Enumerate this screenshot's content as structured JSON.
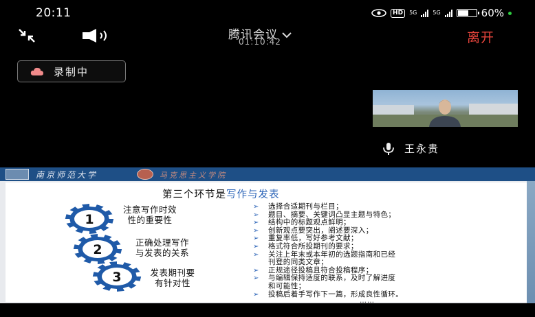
{
  "status_bar": {
    "time": "20:11",
    "hd_label": "HD",
    "net1": "5G",
    "net2": "5G",
    "battery_percent": "60%",
    "battery_level": 0.6
  },
  "toolbar": {
    "meeting_title": "腾讯会议",
    "timer": "01:10:42",
    "leave_label": "离开"
  },
  "record": {
    "label": "录制中"
  },
  "participant": {
    "name": "王永贵"
  },
  "slide": {
    "title_prefix": "第三个环节是",
    "title_highlight": "写作与发表",
    "steps": [
      {
        "number": "1",
        "line1": "注意写作时效",
        "line2": "性的重要性"
      },
      {
        "number": "2",
        "line1": "正确处理写作",
        "line2": "与发表的关系"
      },
      {
        "number": "3",
        "line1": "发表期刊要",
        "line2": "有针对性"
      }
    ],
    "bullets": [
      "选择合适期刊与栏目；",
      "题目、摘要、关键词凸显主题与特色；",
      "结构中的标题观点鲜明；",
      "创新观点要突出，阐述要深入；",
      "重复率低，写好参考文献；",
      "格式符合所投期刊的要求；",
      "关注上年末或本年初的选题指南和已经",
      "刊登的同类文章；",
      "正规途径投稿且符合投稿程序；",
      "与编辑保持适度的联系，及时了解进度",
      "和可能性；",
      "投稿后着手写作下一篇，形成良性循环。"
    ],
    "bullet_has_arrow": [
      true,
      true,
      true,
      true,
      true,
      true,
      true,
      false,
      true,
      true,
      false,
      true
    ],
    "ellipsis": "……"
  },
  "colors": {
    "leave": "#e8453c",
    "slide_accent": "#2a63b7",
    "slide_header": "#1e4f86",
    "gear": "#1f5aa8"
  }
}
